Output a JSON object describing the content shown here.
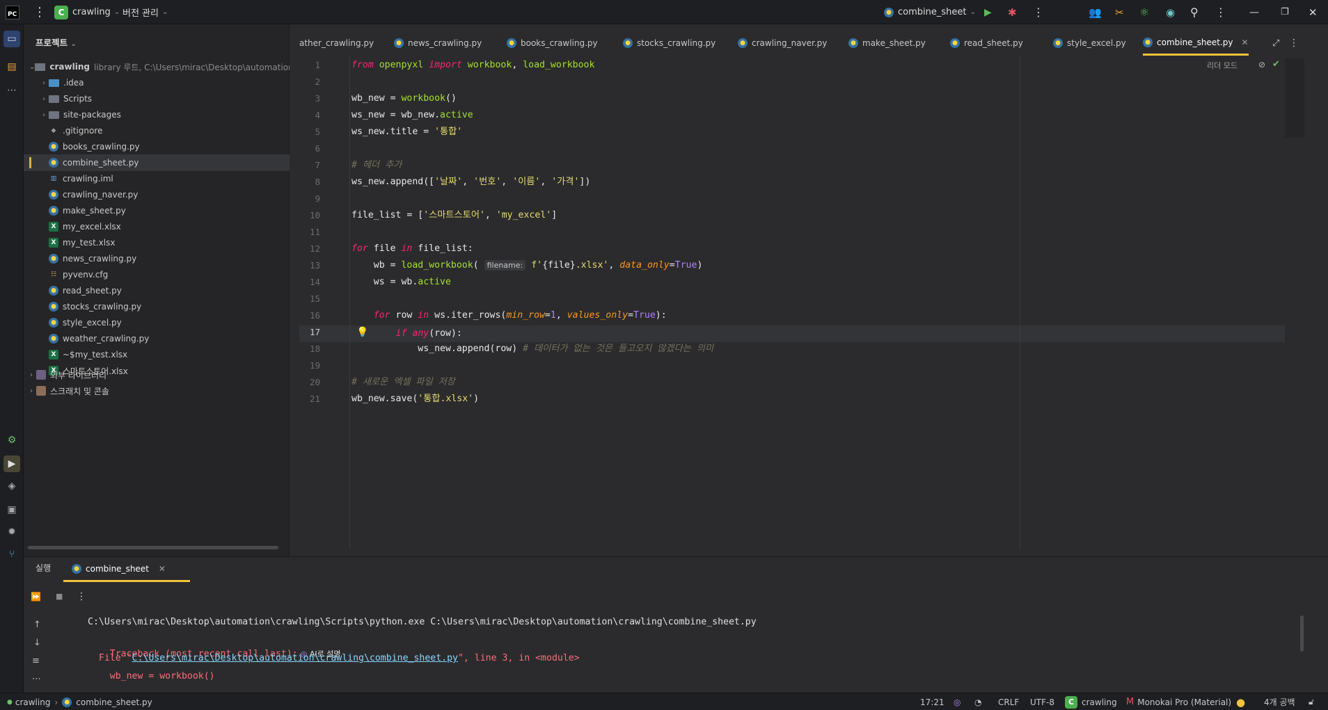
{
  "titlebar": {
    "app_icon": "PC",
    "project_badge": "C",
    "project_name": "crawling",
    "vcs_label": "버전 관리",
    "run_config": "combine_sheet",
    "icons": [
      "menu-icon",
      "run-icon",
      "debug-icon",
      "more-icon",
      "people-icon",
      "tools-icon",
      "atom-icon",
      "ai-icon",
      "search-icon",
      "settings-icon",
      "minimize-icon",
      "restore-icon",
      "close-icon"
    ]
  },
  "project": {
    "title": "프로젝트",
    "root_name": "crawling",
    "root_meta": "library 루트, C:\\Users\\mirac\\Desktop\\automation\\crav",
    "items": [
      {
        "label": ".idea",
        "kind": "folder"
      },
      {
        "label": "Scripts",
        "kind": "folder"
      },
      {
        "label": "site-packages",
        "kind": "folder"
      },
      {
        "label": ".gitignore",
        "kind": "git"
      },
      {
        "label": "books_crawling.py",
        "kind": "py"
      },
      {
        "label": "combine_sheet.py",
        "kind": "py"
      },
      {
        "label": "crawling.iml",
        "kind": "iml"
      },
      {
        "label": "crawling_naver.py",
        "kind": "py"
      },
      {
        "label": "make_sheet.py",
        "kind": "py"
      },
      {
        "label": "my_excel.xlsx",
        "kind": "xl"
      },
      {
        "label": "my_test.xlsx",
        "kind": "xl"
      },
      {
        "label": "news_crawling.py",
        "kind": "py"
      },
      {
        "label": "pyvenv.cfg",
        "kind": "cfg"
      },
      {
        "label": "read_sheet.py",
        "kind": "py"
      },
      {
        "label": "stocks_crawling.py",
        "kind": "py"
      },
      {
        "label": "style_excel.py",
        "kind": "py"
      },
      {
        "label": "weather_crawling.py",
        "kind": "py"
      },
      {
        "label": "~$my_test.xlsx",
        "kind": "xl"
      },
      {
        "label": "스마트스토어.xlsx",
        "kind": "xl"
      }
    ],
    "external_libs": "외부 라이브러리",
    "scratches": "스크래치 및 콘솔"
  },
  "tabs": [
    "ather_crawling.py",
    "news_crawling.py",
    "books_crawling.py",
    "stocks_crawling.py",
    "crawling_naver.py",
    "make_sheet.py",
    "read_sheet.py",
    "style_excel.py",
    "combine_sheet.py"
  ],
  "editor": {
    "reader_mode": "리더 모드",
    "current_line": 17,
    "line_numbers": [
      "1",
      "2",
      "3",
      "4",
      "5",
      "6",
      "7",
      "8",
      "9",
      "10",
      "11",
      "12",
      "13",
      "14",
      "15",
      "16",
      "17",
      "18",
      "19",
      "20",
      "21"
    ]
  },
  "run": {
    "tab_label": "실행",
    "config_tab": "combine_sheet",
    "cmd": "C:\\Users\\mirac\\Desktop\\automation\\crawling\\Scripts\\python.exe C:\\Users\\mirac\\Desktop\\automation\\crawling\\combine_sheet.py",
    "traceback": "Traceback (most recent call last):",
    "explain": "AI로 설명",
    "file_prefix": "  File \"",
    "file_path": "C:\\Users\\mirac\\Desktop\\automation\\crawling\\combine_sheet.py",
    "file_suffix": "\", line 3, in <module>",
    "code": "    wb_new = workbook()"
  },
  "statusbar": {
    "crumb_project": "crawling",
    "crumb_file": "combine_sheet.py",
    "position": "17:21",
    "line_sep": "CRLF",
    "encoding": "UTF-8",
    "interpreter_badge": "C",
    "interpreter": "crawling",
    "theme": "Monokai Pro (Material)",
    "indent": "4개 공백"
  }
}
